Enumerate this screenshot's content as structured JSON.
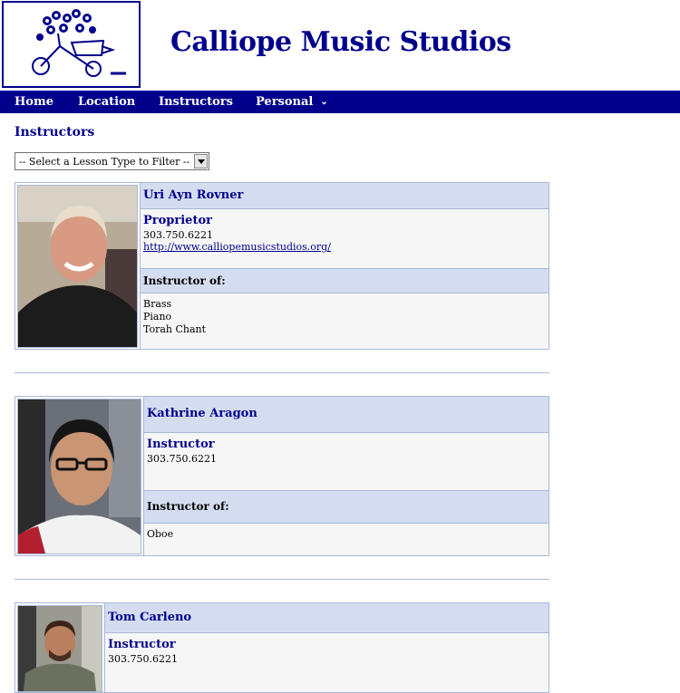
{
  "site": {
    "title": "Calliope Music Studios",
    "logo_icon": "bicycle-flowers-logo"
  },
  "nav": {
    "items": [
      {
        "label": "Home"
      },
      {
        "label": "Location"
      },
      {
        "label": "Instructors"
      },
      {
        "label": "Personal",
        "caret": "chevron-down-icon"
      }
    ]
  },
  "page": {
    "heading": "Instructors",
    "filter": {
      "selected": "-- Select a Lesson Type to Filter --"
    }
  },
  "instructors": [
    {
      "name": "Uri Ayn Rovner",
      "role": "Proprietor",
      "phone": "303.750.6221",
      "url": "http://www.calliopemusicstudios.org/",
      "instructor_of_label": "Instructor of:",
      "lessons": [
        "Brass",
        "Piano",
        "Torah Chant"
      ]
    },
    {
      "name": "Kathrine Aragon",
      "role": "Instructor",
      "phone": "303.750.6221",
      "instructor_of_label": "Instructor of:",
      "lessons": [
        "Oboe"
      ]
    },
    {
      "name": "Tom Carleno",
      "role": "Instructor",
      "phone": "303.750.6221"
    }
  ],
  "colors": {
    "navy": "#00008b",
    "header_cell": "#d4ddf0",
    "body_cell": "#f6f6f6",
    "border": "#a8b8d8"
  }
}
